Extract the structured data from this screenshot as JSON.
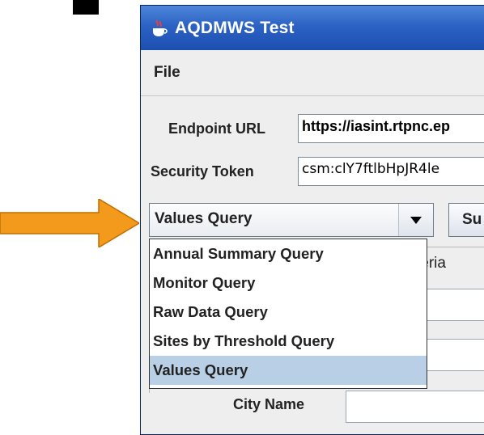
{
  "window": {
    "title": "AQDMWS Test",
    "icon": "java-cup-icon"
  },
  "menubar": {
    "items": [
      {
        "label": "File"
      }
    ]
  },
  "form": {
    "endpoint_label": "Endpoint URL",
    "endpoint_value": "https://iasint.rtpnc.ep",
    "token_label": "Security Token",
    "token_value": "csm:clY7ftlbHpJR4le"
  },
  "query_combo": {
    "selected": "Values Query",
    "options": [
      "Annual Summary Query",
      "Monitor Query",
      "Raw Data Query",
      "Sites by Threshold Query",
      "Values Query"
    ]
  },
  "submit_label": "Su",
  "tab_partial_label": "teria",
  "city_label": "City Name",
  "colors": {
    "arrow": "#f39a1d",
    "titlebar": "#2b62c4",
    "selected_item": "#b8cfe5"
  }
}
